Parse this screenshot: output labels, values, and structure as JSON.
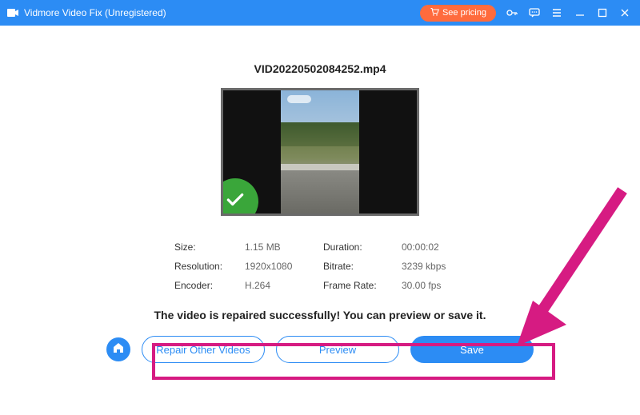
{
  "titlebar": {
    "app_title": "Vidmore Video Fix (Unregistered)",
    "see_pricing_label": "See pricing"
  },
  "file": {
    "name": "VID20220502084252.mp4"
  },
  "meta": {
    "size_label": "Size:",
    "size_value": "1.15 MB",
    "duration_label": "Duration:",
    "duration_value": "00:00:02",
    "resolution_label": "Resolution:",
    "resolution_value": "1920x1080",
    "bitrate_label": "Bitrate:",
    "bitrate_value": "3239 kbps",
    "encoder_label": "Encoder:",
    "encoder_value": "H.264",
    "framerate_label": "Frame Rate:",
    "framerate_value": "30.00 fps"
  },
  "status": {
    "message": "The video is repaired successfully! You can preview or save it."
  },
  "actions": {
    "repair_other_label": "Repair Other Videos",
    "preview_label": "Preview",
    "save_label": "Save"
  }
}
